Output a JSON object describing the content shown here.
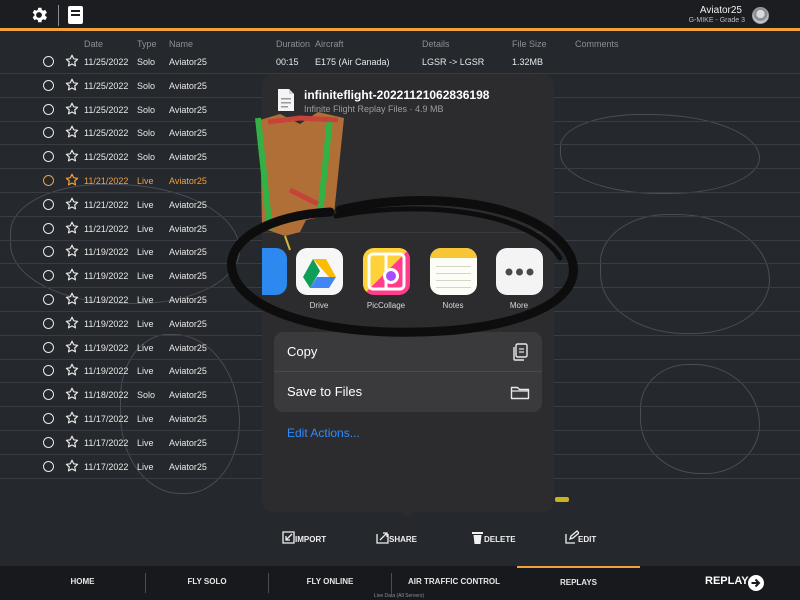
{
  "header": {
    "user_name": "Aviator25",
    "user_sub": "G-MIKE - Grade 3",
    "icons": [
      "gear-icon",
      "logbook-icon",
      "avatar"
    ]
  },
  "table": {
    "columns": {
      "date": "Date",
      "type": "Type",
      "name": "Name",
      "duration": "Duration",
      "aircraft": "Aircraft",
      "details": "Details",
      "filesize": "File Size",
      "comments": "Comments"
    },
    "first_row": {
      "duration": "00:15",
      "aircraft": "E175 (Air Canada)",
      "details": "LGSR -> LGSR",
      "filesize": "1.32MB"
    },
    "rows": [
      {
        "date": "11/25/2022",
        "type": "Solo",
        "name": "Aviator25"
      },
      {
        "date": "11/25/2022",
        "type": "Solo",
        "name": "Aviator25"
      },
      {
        "date": "11/25/2022",
        "type": "Solo",
        "name": "Aviator25"
      },
      {
        "date": "11/25/2022",
        "type": "Solo",
        "name": "Aviator25"
      },
      {
        "date": "11/25/2022",
        "type": "Solo",
        "name": "Aviator25"
      },
      {
        "date": "11/21/2022",
        "type": "Live",
        "name": "Aviator25",
        "highlight": true
      },
      {
        "date": "11/21/2022",
        "type": "Live",
        "name": "Aviator25"
      },
      {
        "date": "11/21/2022",
        "type": "Live",
        "name": "Aviator25"
      },
      {
        "date": "11/19/2022",
        "type": "Live",
        "name": "Aviator25"
      },
      {
        "date": "11/19/2022",
        "type": "Live",
        "name": "Aviator25"
      },
      {
        "date": "11/19/2022",
        "type": "Live",
        "name": "Aviator25"
      },
      {
        "date": "11/19/2022",
        "type": "Live",
        "name": "Aviator25"
      },
      {
        "date": "11/19/2022",
        "type": "Live",
        "name": "Aviator25"
      },
      {
        "date": "11/19/2022",
        "type": "Live",
        "name": "Aviator25"
      },
      {
        "date": "11/18/2022",
        "type": "Solo",
        "name": "Aviator25"
      },
      {
        "date": "11/17/2022",
        "type": "Live",
        "name": "Aviator25"
      },
      {
        "date": "11/17/2022",
        "type": "Live",
        "name": "Aviator25"
      },
      {
        "date": "11/17/2022",
        "type": "Live",
        "name": "Aviator25"
      }
    ]
  },
  "share_sheet": {
    "file_name": "infiniteflight-20221121062836198",
    "file_sub": "Infinite Flight Replay Files · 4.9 MB",
    "apps": [
      {
        "label": "Drive",
        "icon": "google-drive-icon"
      },
      {
        "label": "PicCollage",
        "icon": "piccollage-icon"
      },
      {
        "label": "Notes",
        "icon": "notes-icon"
      },
      {
        "label": "More",
        "icon": "more-icon"
      }
    ],
    "actions": [
      {
        "label": "Copy",
        "icon": "copy-icon"
      },
      {
        "label": "Save to Files",
        "icon": "folder-icon"
      }
    ],
    "edit_actions": "Edit Actions..."
  },
  "action_bar": {
    "import": "IMPORT",
    "share": "SHARE",
    "delete": "DELETE",
    "edit": "EDIT"
  },
  "bottom_nav": {
    "items": [
      "HOME",
      "FLY SOLO",
      "FLY ONLINE",
      "AIR TRAFFIC CONTROL",
      "REPLAYS"
    ],
    "active": "REPLAYS",
    "replay_button": "REPLAY",
    "live_note": "Live Data (All Servers)"
  },
  "colors": {
    "accent": "#f2a13c",
    "link": "#2f8bff",
    "background": "#24272c"
  }
}
